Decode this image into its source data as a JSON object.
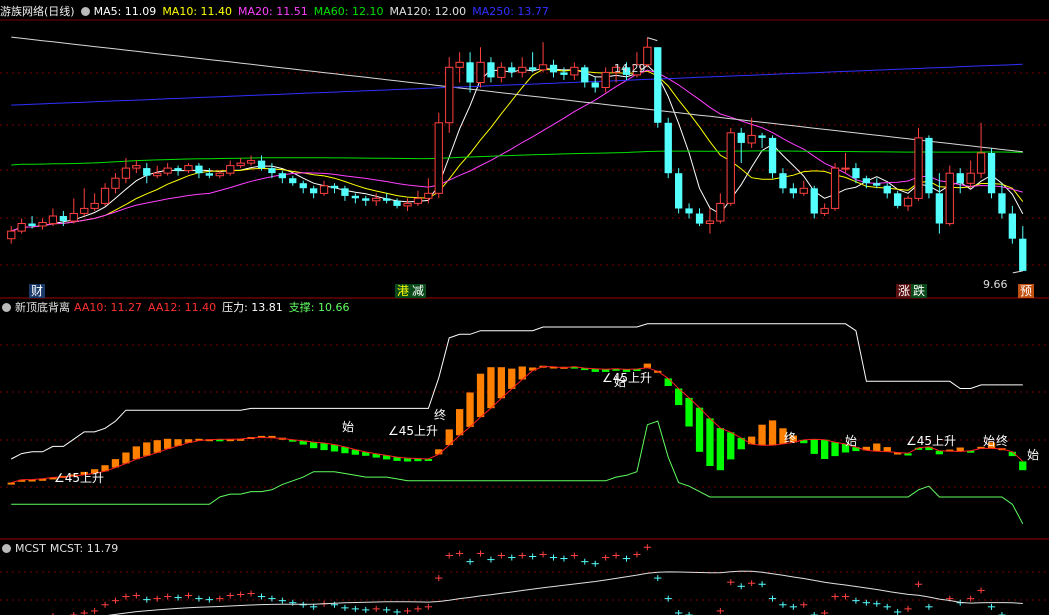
{
  "panels": {
    "main": {
      "title": "游族网络(日线)",
      "indicators": [
        {
          "label": "MA5: 11.09",
          "color": "#ffffff"
        },
        {
          "label": "MA10: 11.40",
          "color": "#ffff00"
        },
        {
          "label": "MA20: 11.51",
          "color": "#ff40ff"
        },
        {
          "label": "MA60: 12.10",
          "color": "#00e000"
        },
        {
          "label": "MA120: 12.00",
          "color": "#e0e0e0"
        },
        {
          "label": "MA250: 13.77",
          "color": "#3030ff"
        }
      ],
      "high_label": "14.29",
      "low_label": "9.66",
      "event_tags": [
        {
          "text": "财",
          "bg": "#1a3a6a",
          "color": "#ffffff"
        },
        {
          "text": "港",
          "bg": "#0a4a1a",
          "color": "#ffff00"
        },
        {
          "text": "减",
          "bg": "#0a4a1a",
          "color": "#ffffff"
        },
        {
          "text": "涨",
          "bg": "#5a1010",
          "color": "#ffffff"
        },
        {
          "text": "跌",
          "bg": "#0a4a1a",
          "color": "#ffffff"
        },
        {
          "text": "预",
          "bg": "#c05010",
          "color": "#ffffff"
        }
      ]
    },
    "mid": {
      "title": "新顶底背离",
      "indicators": [
        {
          "label": "AA10: 11.27",
          "color": "#ff3030"
        },
        {
          "label": "AA12: 11.40",
          "color": "#ff3030"
        },
        {
          "label": "压力: 13.81",
          "color": "#ffffff"
        },
        {
          "label": "支撑: 10.66",
          "color": "#60ff60"
        }
      ],
      "annotations": [
        {
          "text": "∠45上升"
        },
        {
          "text": "始"
        },
        {
          "text": "∠45上升"
        },
        {
          "text": "终"
        },
        {
          "text": "∠45上升"
        },
        {
          "text": "始"
        },
        {
          "text": "终"
        },
        {
          "text": "始"
        },
        {
          "text": "∠45上升"
        },
        {
          "text": "始"
        },
        {
          "text": "终"
        },
        {
          "text": "始"
        }
      ]
    },
    "bottom": {
      "title": "MCST",
      "indicators": [
        {
          "label": "MCST: 11.79",
          "color": "#e0e0e0"
        }
      ]
    }
  },
  "chart_data": {
    "type": "candlestick",
    "price_range": [
      9.4,
      14.6
    ],
    "candles": [
      [
        10.3,
        10.45,
        10.55,
        10.2
      ],
      [
        10.45,
        10.6,
        10.7,
        10.4
      ],
      [
        10.6,
        10.55,
        10.75,
        10.5
      ],
      [
        10.55,
        10.62,
        10.7,
        10.48
      ],
      [
        10.6,
        10.75,
        10.9,
        10.55
      ],
      [
        10.75,
        10.65,
        10.85,
        10.55
      ],
      [
        10.65,
        10.8,
        11.1,
        10.6
      ],
      [
        10.8,
        10.9,
        11.3,
        10.75
      ],
      [
        10.9,
        11.0,
        11.2,
        10.85
      ],
      [
        11.0,
        11.3,
        11.4,
        10.95
      ],
      [
        11.3,
        11.5,
        11.6,
        11.2
      ],
      [
        11.5,
        11.7,
        11.9,
        11.4
      ],
      [
        11.7,
        11.75,
        11.85,
        11.6
      ],
      [
        11.7,
        11.55,
        11.8,
        11.4
      ],
      [
        11.55,
        11.6,
        11.75,
        11.5
      ],
      [
        11.6,
        11.7,
        11.8,
        11.55
      ],
      [
        11.7,
        11.65,
        11.75,
        11.55
      ],
      [
        11.65,
        11.75,
        11.8,
        11.6
      ],
      [
        11.75,
        11.6,
        11.8,
        11.5
      ],
      [
        11.6,
        11.55,
        11.7,
        11.5
      ],
      [
        11.55,
        11.6,
        11.65,
        11.5
      ],
      [
        11.6,
        11.75,
        11.85,
        11.55
      ],
      [
        11.75,
        11.8,
        11.9,
        11.7
      ],
      [
        11.8,
        11.85,
        11.95,
        11.75
      ],
      [
        11.85,
        11.7,
        11.95,
        11.65
      ],
      [
        11.7,
        11.6,
        11.8,
        11.5
      ],
      [
        11.6,
        11.5,
        11.65,
        11.4
      ],
      [
        11.5,
        11.4,
        11.55,
        11.35
      ],
      [
        11.4,
        11.3,
        11.45,
        11.2
      ],
      [
        11.3,
        11.2,
        11.35,
        11.1
      ],
      [
        11.2,
        11.35,
        11.45,
        11.15
      ],
      [
        11.35,
        11.3,
        11.4,
        11.2
      ],
      [
        11.3,
        11.15,
        11.35,
        11.05
      ],
      [
        11.15,
        11.1,
        11.2,
        11.0
      ],
      [
        11.1,
        11.05,
        11.15,
        10.95
      ],
      [
        11.05,
        11.1,
        11.2,
        10.95
      ],
      [
        11.1,
        11.05,
        11.2,
        11.0
      ],
      [
        11.05,
        10.95,
        11.1,
        10.9
      ],
      [
        10.95,
        11.0,
        11.1,
        10.85
      ],
      [
        11.0,
        11.1,
        11.25,
        10.95
      ],
      [
        11.1,
        11.2,
        11.5,
        11.0
      ],
      [
        11.2,
        12.6,
        12.8,
        11.1
      ],
      [
        12.6,
        13.7,
        13.9,
        12.4
      ],
      [
        13.7,
        13.8,
        14.0,
        13.4
      ],
      [
        13.8,
        13.4,
        14.0,
        13.2
      ],
      [
        13.4,
        13.8,
        14.1,
        13.3
      ],
      [
        13.8,
        13.5,
        13.9,
        13.4
      ],
      [
        13.5,
        13.7,
        13.8,
        13.4
      ],
      [
        13.7,
        13.6,
        13.8,
        13.5
      ],
      [
        13.6,
        13.7,
        13.9,
        13.5
      ],
      [
        13.7,
        13.65,
        14.0,
        13.6
      ],
      [
        13.65,
        13.75,
        14.2,
        13.6
      ],
      [
        13.75,
        13.6,
        13.85,
        13.5
      ],
      [
        13.6,
        13.55,
        13.7,
        13.45
      ],
      [
        13.55,
        13.7,
        13.8,
        13.45
      ],
      [
        13.7,
        13.4,
        13.75,
        13.3
      ],
      [
        13.4,
        13.3,
        13.5,
        13.2
      ],
      [
        13.3,
        13.6,
        13.7,
        13.2
      ],
      [
        13.6,
        13.7,
        13.75,
        13.4
      ],
      [
        13.7,
        13.55,
        13.8,
        13.45
      ],
      [
        13.55,
        13.75,
        14.0,
        13.5
      ],
      [
        13.75,
        14.1,
        14.29,
        13.7
      ],
      [
        14.1,
        12.6,
        14.1,
        12.5
      ],
      [
        12.6,
        11.6,
        12.7,
        11.5
      ],
      [
        11.6,
        10.9,
        11.7,
        10.8
      ],
      [
        10.9,
        10.8,
        11.0,
        10.7
      ],
      [
        10.8,
        10.6,
        10.9,
        10.55
      ],
      [
        10.6,
        10.65,
        10.9,
        10.4
      ],
      [
        10.65,
        11.0,
        11.2,
        10.6
      ],
      [
        11.0,
        12.4,
        12.5,
        10.95
      ],
      [
        12.4,
        12.2,
        12.5,
        11.8
      ],
      [
        12.2,
        12.35,
        12.7,
        12.1
      ],
      [
        12.35,
        12.3,
        12.4,
        12.1
      ],
      [
        12.3,
        11.6,
        12.35,
        11.5
      ],
      [
        11.6,
        11.3,
        11.7,
        11.2
      ],
      [
        11.3,
        11.2,
        11.4,
        11.1
      ],
      [
        11.2,
        11.3,
        11.45,
        11.15
      ],
      [
        11.3,
        10.8,
        11.35,
        10.7
      ],
      [
        10.8,
        10.9,
        11.0,
        10.75
      ],
      [
        10.9,
        11.7,
        11.8,
        10.85
      ],
      [
        11.7,
        11.7,
        12.0,
        11.6
      ],
      [
        11.7,
        11.5,
        11.8,
        11.4
      ],
      [
        11.5,
        11.4,
        11.55,
        11.3
      ],
      [
        11.4,
        11.35,
        11.5,
        11.3
      ],
      [
        11.35,
        11.2,
        11.4,
        11.1
      ],
      [
        11.2,
        10.95,
        11.25,
        10.9
      ],
      [
        10.95,
        11.1,
        11.15,
        10.85
      ],
      [
        11.1,
        12.3,
        12.5,
        11.05
      ],
      [
        12.3,
        11.2,
        12.35,
        11.1
      ],
      [
        11.2,
        10.6,
        11.6,
        10.4
      ],
      [
        10.6,
        11.6,
        11.75,
        10.55
      ],
      [
        11.6,
        11.4,
        11.7,
        11.2
      ],
      [
        11.4,
        11.6,
        11.85,
        11.3
      ],
      [
        11.6,
        12.0,
        12.6,
        11.5
      ],
      [
        12.0,
        11.2,
        12.1,
        11.1
      ],
      [
        11.2,
        10.8,
        11.4,
        10.7
      ],
      [
        10.8,
        10.3,
        10.95,
        10.2
      ],
      [
        10.3,
        9.66,
        10.55,
        9.66
      ]
    ],
    "ma_series": [
      {
        "name": "MA5",
        "color": "#ffffff"
      },
      {
        "name": "MA10",
        "color": "#ffff00"
      },
      {
        "name": "MA20",
        "color": "#ff40ff"
      },
      {
        "name": "MA60",
        "color": "#00e000"
      },
      {
        "name": "MA120",
        "color": "#d8d8d8"
      },
      {
        "name": "MA250",
        "color": "#3030ff"
      }
    ],
    "mid_range": [
      9.0,
      15.0
    ],
    "mcst_range": [
      9.0,
      15.0
    ]
  }
}
